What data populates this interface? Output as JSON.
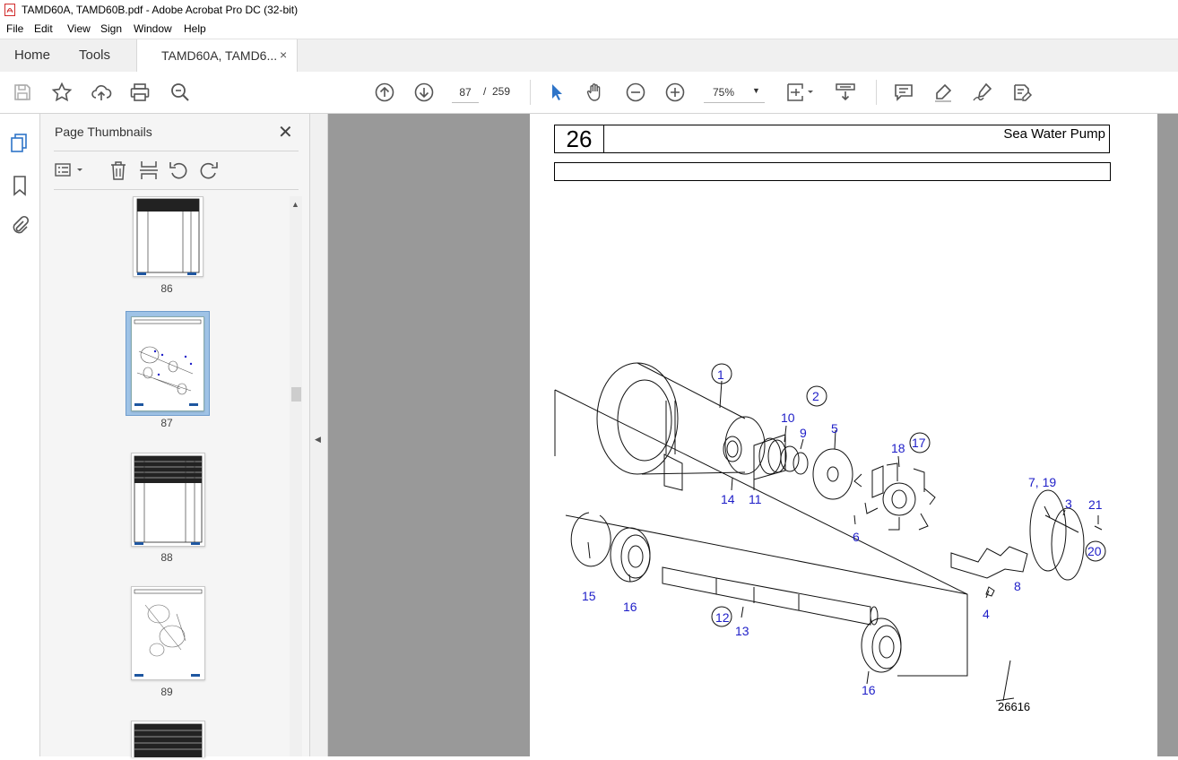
{
  "window": {
    "title": "TAMD60A, TAMD60B.pdf - Adobe Acrobat Pro DC (32-bit)"
  },
  "menu": [
    "File",
    "Edit",
    "View",
    "Sign",
    "Window",
    "Help"
  ],
  "tabs": {
    "home": "Home",
    "tools": "Tools",
    "document": "TAMD60A, TAMD6...",
    "close": "×"
  },
  "toolbar": {
    "current_page": "87",
    "separator": "/",
    "total_pages": "259",
    "zoom": "75%",
    "icons": [
      "save-icon",
      "star-icon",
      "upload-icon",
      "print-icon",
      "search-zoom-icon",
      "page-up-icon",
      "page-down-icon",
      "select-cursor-icon",
      "hand-icon",
      "zoom-out-icon",
      "zoom-in-icon",
      "zoom-dropdown-icon",
      "fit-page-icon",
      "scroll-mode-icon",
      "comment-icon",
      "highlight-icon",
      "sign-icon",
      "edit-pdf-icon"
    ]
  },
  "panel": {
    "title": "Page Thumbnails",
    "close": "✕",
    "thumbnails": [
      {
        "label": "86"
      },
      {
        "label": "87",
        "selected": true
      },
      {
        "label": "88"
      },
      {
        "label": "89"
      }
    ]
  },
  "page": {
    "number": "26",
    "title": "Sea Water Pump",
    "figure_id": "26616",
    "callouts": [
      "1",
      "2",
      "10",
      "9",
      "5",
      "18",
      "17",
      "7, 19",
      "3",
      "21",
      "20",
      "8",
      "4",
      "6",
      "14",
      "11",
      "15",
      "16",
      "12",
      "13",
      "16"
    ]
  },
  "colors": {
    "callout": "#1e1ec8",
    "doc_bg": "#999999",
    "selected_thumb": "#9fc3e6"
  }
}
